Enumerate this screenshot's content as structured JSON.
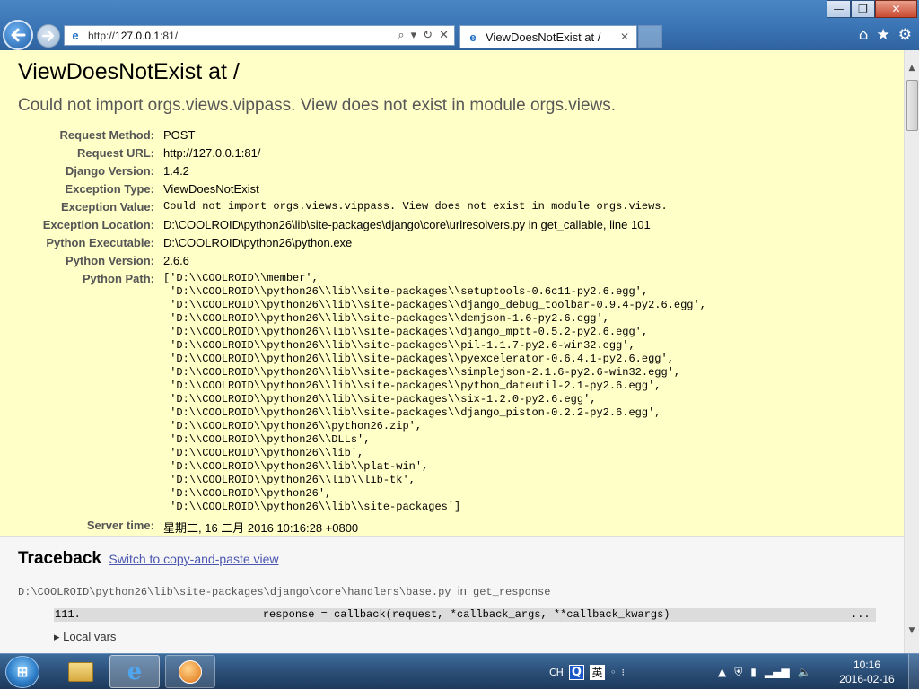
{
  "browser": {
    "url_prefix": "http://",
    "url_host": "127.0.0.1",
    "url_rest": ":81/",
    "tab_title": "ViewDoesNotExist at /"
  },
  "window_controls": {
    "minimize": "—",
    "maximize": "❐",
    "close": "✕"
  },
  "page": {
    "title": "ViewDoesNotExist at /",
    "exception_message": "Could not import orgs.views.vippass. View does not exist in module orgs.views.",
    "meta": [
      {
        "key": "Request Method:",
        "value": "POST",
        "mono": false
      },
      {
        "key": "Request URL:",
        "value": "http://127.0.0.1:81/",
        "mono": false
      },
      {
        "key": "Django Version:",
        "value": "1.4.2",
        "mono": false
      },
      {
        "key": "Exception Type:",
        "value": "ViewDoesNotExist",
        "mono": false
      },
      {
        "key": "Exception Value:",
        "value": "Could not import orgs.views.vippass. View does not exist in module orgs.views.",
        "mono": true
      },
      {
        "key": "Exception Location:",
        "value": "D:\\COOLROID\\python26\\lib\\site-packages\\django\\core\\urlresolvers.py in get_callable, line 101",
        "mono": false
      },
      {
        "key": "Python Executable:",
        "value": "D:\\COOLROID\\python26\\python.exe",
        "mono": false
      },
      {
        "key": "Python Version:",
        "value": "2.6.6",
        "mono": false
      }
    ],
    "python_path_label": "Python Path:",
    "python_path": "['D:\\\\COOLROID\\\\member',\n 'D:\\\\COOLROID\\\\python26\\\\lib\\\\site-packages\\\\setuptools-0.6c11-py2.6.egg',\n 'D:\\\\COOLROID\\\\python26\\\\lib\\\\site-packages\\\\django_debug_toolbar-0.9.4-py2.6.egg',\n 'D:\\\\COOLROID\\\\python26\\\\lib\\\\site-packages\\\\demjson-1.6-py2.6.egg',\n 'D:\\\\COOLROID\\\\python26\\\\lib\\\\site-packages\\\\django_mptt-0.5.2-py2.6.egg',\n 'D:\\\\COOLROID\\\\python26\\\\lib\\\\site-packages\\\\pil-1.1.7-py2.6-win32.egg',\n 'D:\\\\COOLROID\\\\python26\\\\lib\\\\site-packages\\\\pyexcelerator-0.6.4.1-py2.6.egg',\n 'D:\\\\COOLROID\\\\python26\\\\lib\\\\site-packages\\\\simplejson-2.1.6-py2.6-win32.egg',\n 'D:\\\\COOLROID\\\\python26\\\\lib\\\\site-packages\\\\python_dateutil-2.1-py2.6.egg',\n 'D:\\\\COOLROID\\\\python26\\\\lib\\\\site-packages\\\\six-1.2.0-py2.6.egg',\n 'D:\\\\COOLROID\\\\python26\\\\lib\\\\site-packages\\\\django_piston-0.2.2-py2.6.egg',\n 'D:\\\\COOLROID\\\\python26\\\\python26.zip',\n 'D:\\\\COOLROID\\\\python26\\\\DLLs',\n 'D:\\\\COOLROID\\\\python26\\\\lib',\n 'D:\\\\COOLROID\\\\python26\\\\lib\\\\plat-win',\n 'D:\\\\COOLROID\\\\python26\\\\lib\\\\lib-tk',\n 'D:\\\\COOLROID\\\\python26',\n 'D:\\\\COOLROID\\\\python26\\\\lib\\\\site-packages']",
    "server_time_label": "Server time:",
    "server_time": "星期二, 16 二月 2016 10:16:28 +0800"
  },
  "traceback": {
    "heading": "Traceback",
    "copy_paste_link": "Switch to copy-and-paste view",
    "frame_file": "D:\\COOLROID\\python26\\lib\\site-packages\\django\\core\\handlers\\base.py",
    "frame_in": "in",
    "frame_function": "get_response",
    "line_number": "111.",
    "code": "                        response = callback(request, *callback_args, **callback_kwargs)",
    "dots": "...",
    "local_vars": "Local vars"
  },
  "taskbar": {
    "ime_ch": "CH",
    "ime_q": "Q",
    "ime_lang": "英",
    "clock_time": "10:16",
    "clock_date": "2016-02-16"
  },
  "icons": {
    "back": "back-arrow-icon",
    "forward": "forward-arrow-icon",
    "search": "search-icon",
    "refresh": "refresh-icon",
    "home": "home-icon",
    "favorites": "star-icon",
    "tools": "gear-icon"
  },
  "colors": {
    "summary_bg": "#ffffc8",
    "traceback_bg": "#f6f6f6",
    "context_line_bg": "#dcdcdc",
    "link": "#4b56b0"
  }
}
